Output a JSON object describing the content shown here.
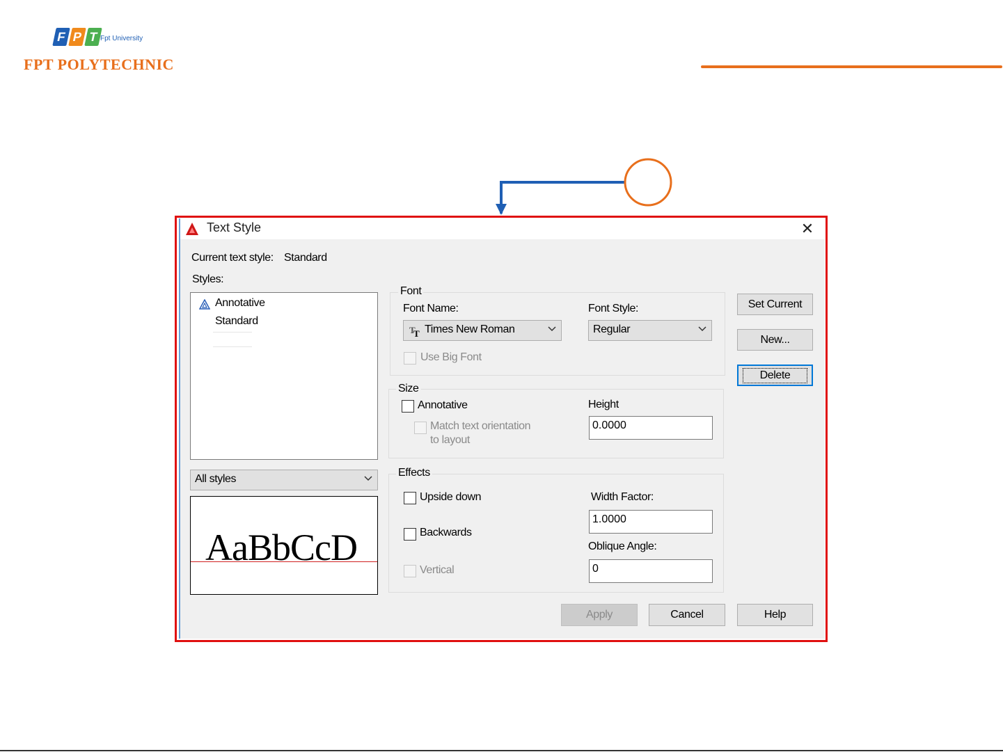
{
  "slide": {
    "logo_university": "Fpt University",
    "logo_brand": "FPT POLYTECHNIC",
    "logo_letters": [
      "F",
      "P",
      "T"
    ]
  },
  "colors": {
    "brand_orange": "#e86f1c",
    "brand_blue": "#1f5fb4",
    "highlight_red": "#e01010",
    "arrow_blue": "#1f5fb4"
  },
  "dialog": {
    "title": "Text Style",
    "current_style_label": "Current text style:",
    "current_style_value": "Standard",
    "styles_label": "Styles:",
    "styles": [
      "Annotative",
      "Standard"
    ],
    "styles_filter": "All styles",
    "preview_text": "AaBbCcD",
    "font": {
      "group_title": "Font",
      "font_name_label": "Font Name:",
      "font_name_value": "Times New Roman",
      "font_style_label": "Font Style:",
      "font_style_value": "Regular",
      "use_big_font_label": "Use Big Font"
    },
    "size": {
      "group_title": "Size",
      "annotative_label": "Annotative",
      "match_orientation_label_1": "Match text orientation",
      "match_orientation_label_2": "to layout",
      "height_label": "Height",
      "height_value": "0.0000"
    },
    "effects": {
      "group_title": "Effects",
      "upside_down_label": "Upside down",
      "backwards_label": "Backwards",
      "vertical_label": "Vertical",
      "width_factor_label": "Width Factor:",
      "width_factor_value": "1.0000",
      "oblique_angle_label": "Oblique Angle:",
      "oblique_angle_value": "0"
    },
    "buttons": {
      "set_current": "Set Current",
      "new": "New...",
      "delete": "Delete",
      "apply": "Apply",
      "cancel": "Cancel",
      "help": "Help"
    },
    "icons": [
      "autocad-icon",
      "close-icon",
      "annotative-style-icon",
      "truetype-font-icon",
      "chevron-down-icon"
    ]
  }
}
